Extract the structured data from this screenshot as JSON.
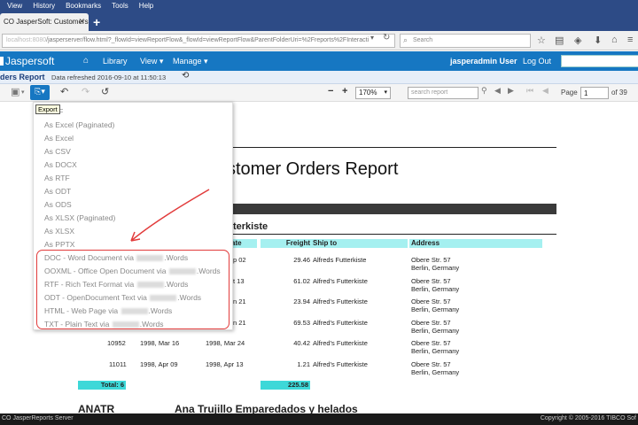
{
  "browser": {
    "menu": [
      "View",
      "History",
      "Bookmarks",
      "Tools",
      "Help"
    ],
    "tab_title": "CO JasperSoft: Customers...",
    "new_tab": "+",
    "url_host": "localhost:8080",
    "url_path": "/jasperserver/flow.html?_flowId=viewReportFlow&_flowId=viewReportFlow&ParentFolderUri=%2Freports%2FInteracti",
    "search_placeholder": "Search"
  },
  "header": {
    "logo": "Jaspersoft",
    "library": "Library",
    "view": "View",
    "manage": "Manage",
    "user": "jasperadmin User",
    "logout": "Log Out"
  },
  "report_bar": {
    "title": "ders Report",
    "refreshed": "Data refreshed 2016-09-10 at 11:50:13"
  },
  "toolbar": {
    "zoom": "170%",
    "search_placeholder": "search report",
    "page_label": "Page",
    "page_value": "1",
    "page_of": "of 39"
  },
  "tooltip": "Export",
  "export_menu": {
    "items": [
      "DF",
      "As Excel (Paginated)",
      "As Excel",
      "As CSV",
      "As DOCX",
      "As RTF",
      "As ODT",
      "As ODS",
      "As XLSX (Paginated)",
      "As XLSX",
      "As PPTX"
    ],
    "plugin_items": [
      {
        "prefix": "DOC - Word Document via",
        "suffix": ".Words"
      },
      {
        "prefix": "OOXML - Office Open Document via",
        "suffix": ".Words"
      },
      {
        "prefix": "RTF - Rich Text Format via",
        "suffix": ".Words"
      },
      {
        "prefix": "ODT - OpenDocument Text via",
        "suffix": ".Words"
      },
      {
        "prefix": "HTML - Web Page via",
        "suffix": ".Words"
      },
      {
        "prefix": "TXT - Plain Text via",
        "suffix": ".Words"
      }
    ]
  },
  "report": {
    "heading": "stomer Orders Report",
    "customer": "terkiste",
    "columns": [
      "ate",
      "Freight",
      "Ship to",
      "Address"
    ],
    "rows": [
      {
        "id": "",
        "order_date": "",
        "ship_date": "p 02",
        "freight": "29.46",
        "ship_to": "Alfreds Futterkiste",
        "addr1": "Obere Str. 57",
        "addr2": "Berlin, Germany"
      },
      {
        "id": "",
        "order_date": "",
        "ship_date": "t 13",
        "freight": "61.02",
        "ship_to": "Alfred's Futterkiste",
        "addr1": "Obere Str. 57",
        "addr2": "Berlin, Germany"
      },
      {
        "id": "",
        "order_date": "",
        "ship_date": "n 21",
        "freight": "23.94",
        "ship_to": "Alfred's Futterkiste",
        "addr1": "Obere Str. 57",
        "addr2": "Berlin, Germany"
      },
      {
        "id": "",
        "order_date": "",
        "ship_date": "n 21",
        "freight": "69.53",
        "ship_to": "Alfred's Futterkiste",
        "addr1": "Obere Str. 57",
        "addr2": "Berlin, Germany"
      },
      {
        "id": "10952",
        "order_date": "1998, Mar 16",
        "ship_date": "1998, Mar 24",
        "freight": "40.42",
        "ship_to": "Alfred's Futterkiste",
        "addr1": "Obere Str. 57",
        "addr2": "Berlin, Germany"
      },
      {
        "id": "11011",
        "order_date": "1998, Apr 09",
        "ship_date": "1998, Apr 13",
        "freight": "1.21",
        "ship_to": "Alfred's Futterkiste",
        "addr1": "Obere Str. 57",
        "addr2": "Berlin, Germany"
      }
    ],
    "total_label": "Total: 6",
    "total_freight": "225.58",
    "next_customer_id": "ANATR",
    "next_customer_name": "Ana Trujillo Emparedados y helados"
  },
  "status": {
    "left": "CO JasperReports Server",
    "right": "Copyright © 2005-2016 TIBCO Sof"
  },
  "colors": {
    "brand": "#1677c2",
    "highlight": "#e23b3b",
    "header_cell": "#a5f0f0",
    "total_cell": "#3dd8d8"
  }
}
